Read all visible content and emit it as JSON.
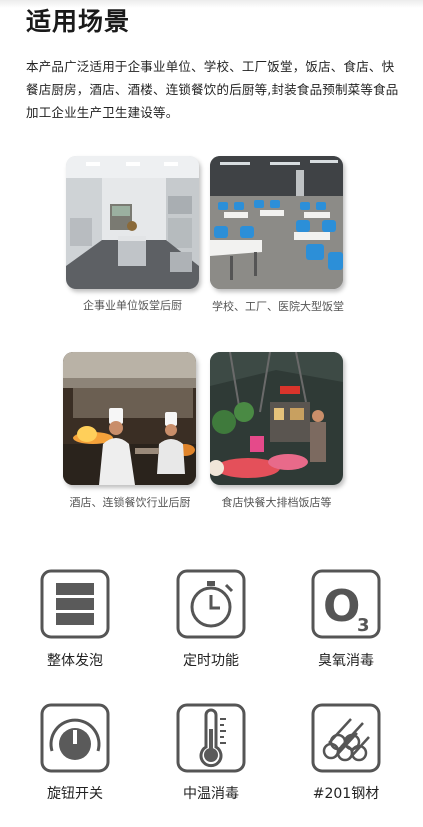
{
  "title": "适用场景",
  "description": "本产品广泛适用于企事业单位、学校、工厂饭堂，饭店、食店、快餐店厨房，酒店、酒楼、连锁餐饮的后厨等,封装食品预制菜等食品加工企业生产卫生建设等。",
  "scenes": [
    {
      "image": "commercial-kitchen-photo",
      "caption": "企事业单位饭堂后厨"
    },
    {
      "image": "canteen-dining-hall-photo",
      "caption": "学校、工厂、医院大型饭堂"
    },
    {
      "image": "restaurant-chefs-photo",
      "caption": "酒店、连锁餐饮行业后厨"
    },
    {
      "image": "food-stall-photo",
      "caption": "食店快餐大排档饭店等"
    }
  ],
  "features": [
    {
      "icon": "overall-foaming-icon",
      "label": "整体发泡"
    },
    {
      "icon": "timer-icon",
      "label": "定时功能"
    },
    {
      "icon": "ozone-icon",
      "label": "臭氧消毒",
      "icon_text": "O",
      "icon_sub": "3"
    },
    {
      "icon": "rotary-knob-icon",
      "label": "旋钮开关"
    },
    {
      "icon": "thermometer-icon",
      "label": "中温消毒"
    },
    {
      "icon": "steel-bars-icon",
      "label": "#201钢材"
    }
  ],
  "colors": {
    "icon_stroke": "#555555",
    "icon_fill": "#5a5a5a"
  }
}
